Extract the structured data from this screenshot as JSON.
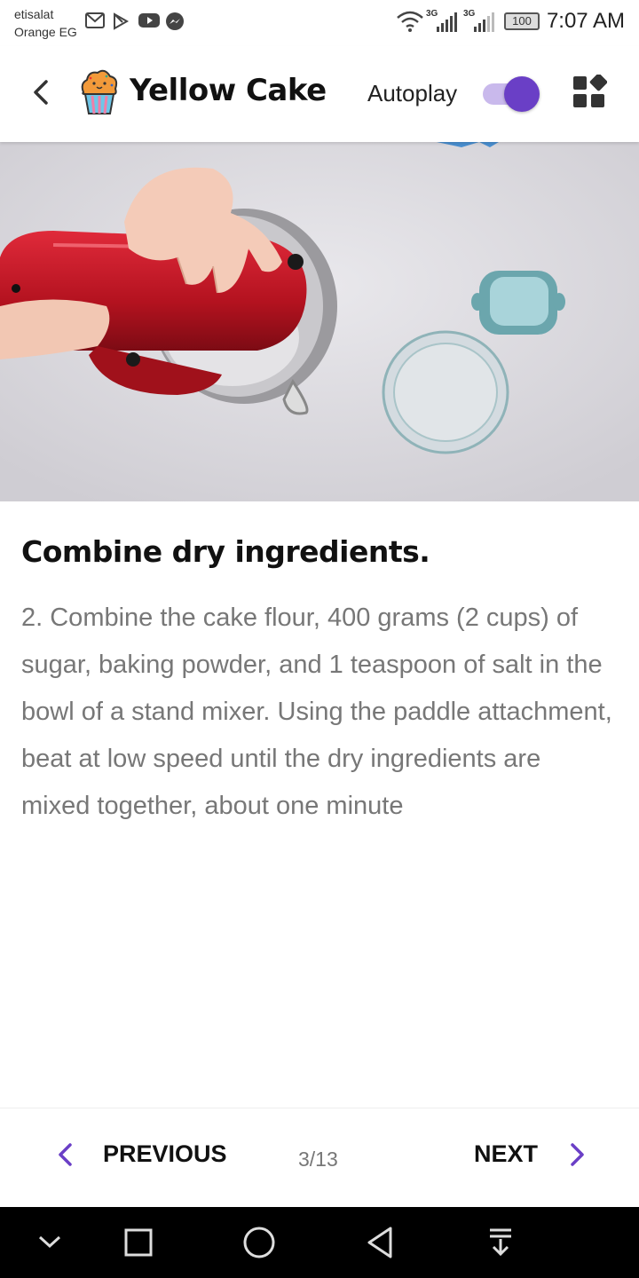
{
  "status_bar": {
    "carrier_line1": "etisalat",
    "carrier_line2": "Orange EG",
    "network1": "3G",
    "network2": "3G",
    "battery": "100",
    "time": "7:07 AM",
    "notification_icons": [
      "gmail-icon",
      "play-store-icon",
      "youtube-icon",
      "messenger-icon"
    ]
  },
  "header": {
    "title": "Yellow Cake",
    "autoplay_label": "Autoplay",
    "autoplay_on": true,
    "accent_color": "#6a3fc6"
  },
  "step": {
    "title": "Combine dry ingredients.",
    "body": "2. Combine the cake flour, 400 grams (2 cups) of sugar, baking powder, and 1 teaspoon of salt in the bowl of a stand mixer. Using the paddle attachment, beat at low speed until the dry ingredients are mixed together, about one minute"
  },
  "navigation": {
    "previous_label": "PREVIOUS",
    "next_label": "NEXT",
    "page_indicator": "3/13"
  }
}
